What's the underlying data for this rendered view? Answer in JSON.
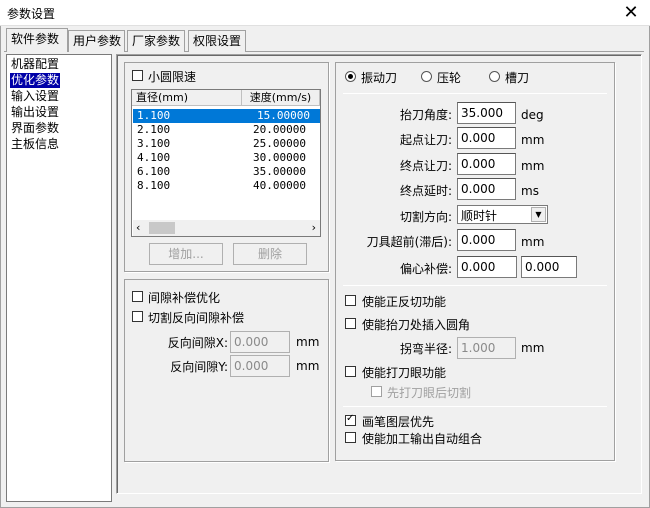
{
  "window": {
    "title": "参数设置"
  },
  "tabs": [
    {
      "label": "软件参数"
    },
    {
      "label": "用户参数"
    },
    {
      "label": "厂家参数"
    },
    {
      "label": "权限设置"
    }
  ],
  "nav": {
    "items": [
      "机器配置",
      "优化参数",
      "输入设置",
      "输出设置",
      "界面参数",
      "主板信息"
    ],
    "selected": 1
  },
  "small_circle": {
    "label": "小圆限速",
    "checked": false,
    "columns": [
      "直径(mm)",
      "速度(mm/s)"
    ],
    "rows": [
      {
        "diameter": "1.100",
        "speed": "15.00000"
      },
      {
        "diameter": "2.100",
        "speed": "20.00000"
      },
      {
        "diameter": "3.100",
        "speed": "25.00000"
      },
      {
        "diameter": "4.100",
        "speed": "30.00000"
      },
      {
        "diameter": "6.100",
        "speed": "35.00000"
      },
      {
        "diameter": "8.100",
        "speed": "40.00000"
      }
    ],
    "add_label": "增加...",
    "delete_label": "删除"
  },
  "gap": {
    "optimize_label": "间隙补偿优化",
    "reverse_label": "切割反向间隙补偿",
    "x_label": "反向间隙X:",
    "x_value": "0.000",
    "y_label": "反向间隙Y:",
    "y_value": "0.000",
    "unit": "mm"
  },
  "tool": {
    "options": [
      "振动刀",
      "压轮",
      "槽刀"
    ],
    "selected": 0,
    "lift_angle_label": "抬刀角度:",
    "lift_angle_value": "35.000",
    "lift_angle_unit": "deg",
    "start_offset_label": "起点让刀:",
    "start_offset_value": "0.000",
    "end_offset_label": "终点让刀:",
    "end_offset_value": "0.000",
    "end_delay_label": "终点延时:",
    "end_delay_value": "0.000",
    "mm": "mm",
    "ms": "ms",
    "direction_label": "切割方向:",
    "direction_value": "顺时针",
    "advance_label": "刀具超前(滞后):",
    "advance_value": "0.000",
    "offset_label": "偏心补偿:",
    "offset_x": "0.000",
    "offset_y": "0.000"
  },
  "options": {
    "reverse_cut_label": "使能正反切功能",
    "arc_label": "使能抬刀处插入圆角",
    "arc_radius_label": "拐弯半径:",
    "arc_radius_value": "1.000",
    "arc_radius_unit": "mm",
    "eye_label": "使能打刀眼功能",
    "eye_first_label": "先打刀眼后切割",
    "pen_layer_label": "画笔图层优先",
    "auto_combine_label": "使能加工输出自动组合"
  }
}
